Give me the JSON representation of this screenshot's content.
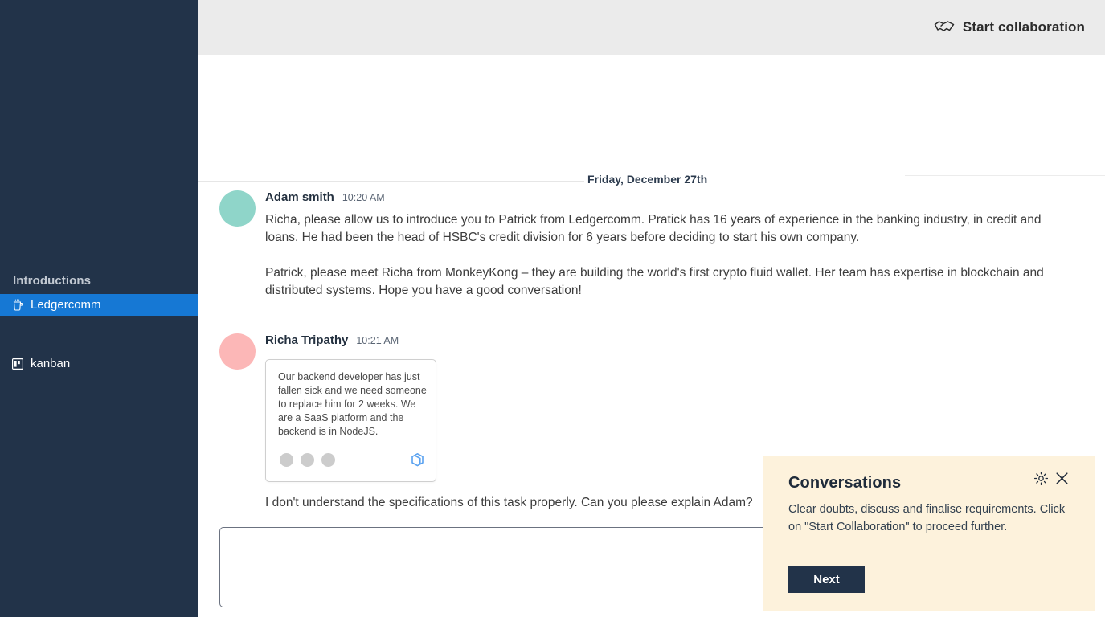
{
  "colors": {
    "sidebar_bg": "#223349",
    "sidebar_active": "#1678d4",
    "header_bg": "#ebebeb",
    "popup_bg": "#fdf2dc",
    "next_btn_bg": "#223349",
    "avatar_adam": "#8fd5c9",
    "avatar_richa": "#fcb7b7",
    "brand_logo": "#5aa2f0"
  },
  "sidebar": {
    "section_label": "Introductions",
    "items": [
      {
        "label": "Ledgercomm",
        "icon": "cup-icon",
        "active": true
      },
      {
        "label": "kanban",
        "icon": "board-icon",
        "active": false
      }
    ]
  },
  "header": {
    "start_collaboration_label": "Start collaboration",
    "start_collaboration_icon": "handshake-icon"
  },
  "chat": {
    "date_divider": "Friday, December 27th",
    "messages": [
      {
        "author": "Adam smith",
        "time": "10:20 AM",
        "avatar_color": "teal",
        "paragraphs": [
          "Richa, please allow us to introduce you to Patrick from Ledgercomm. Pratick has 16 years of experience in the banking industry, in credit and loans. He had been the head of HSBC's credit division for 6 years before deciding to start his own company.",
          "Patrick, please meet Richa from MonkeyKong – they are building the world's first crypto fluid wallet. Her team has expertise in blockchain and distributed systems. Hope you have a good conversation!"
        ]
      },
      {
        "author": "Richa Tripathy",
        "time": "10:21 AM",
        "avatar_color": "pink",
        "card": {
          "text": "Our backend developer has just fallen sick and we need someone to replace him for 2 weeks. We are a SaaS platform and the backend is in NodeJS.",
          "brand_icon": "cube-logo-icon",
          "dot_count": 3
        },
        "trailing_text": "I don't understand the specifications of this task properly. Can you please explain Adam?"
      }
    ],
    "composer": {
      "value": "",
      "placeholder": ""
    }
  },
  "popup": {
    "title": "Conversations",
    "description": "Clear doubts, discuss and finalise requirements. Click on \"Start Collaboration\" to proceed further.",
    "next_label": "Next",
    "settings_icon": "gear-icon",
    "close_icon": "close-icon"
  }
}
